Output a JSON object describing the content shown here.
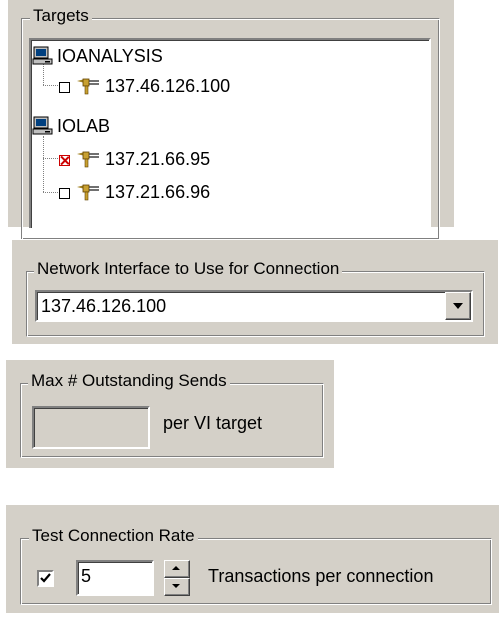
{
  "targets": {
    "legend": "Targets",
    "tree": [
      {
        "host": "IOANALYSIS",
        "addresses": [
          {
            "ip": "137.46.126.100",
            "checked": false
          }
        ]
      },
      {
        "host": "IOLAB",
        "addresses": [
          {
            "ip": "137.21.66.95",
            "checked": true
          },
          {
            "ip": "137.21.66.96",
            "checked": false
          }
        ]
      }
    ]
  },
  "network_interface": {
    "legend": "Network Interface to Use for Connection",
    "selected": "137.46.126.100"
  },
  "max_outstanding": {
    "legend": "Max # Outstanding Sends",
    "value": "",
    "unit_label": "per VI target"
  },
  "test_connection": {
    "legend": "Test Connection Rate",
    "enabled": true,
    "value": "5",
    "unit_label": "Transactions per connection"
  },
  "colors": {
    "panel": "#d4d0c8",
    "checked_mark": "#cc0000"
  }
}
